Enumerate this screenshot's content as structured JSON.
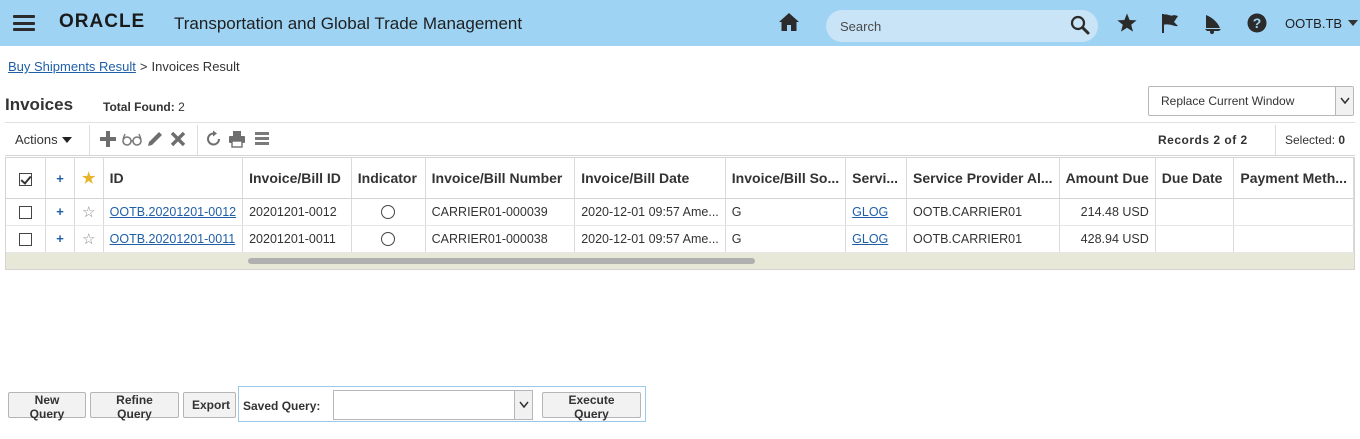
{
  "header": {
    "logo": "ORACLE",
    "app_title": "Transportation and Global Trade Management",
    "search_placeholder": "Search",
    "user": "OOTB.TB"
  },
  "breadcrumb": {
    "parent": "Buy Shipments Result",
    "separator": ">",
    "current": "Invoices Result"
  },
  "page": {
    "title": "Invoices",
    "total_found_label": "Total Found:",
    "total_found_value": "2",
    "window_mode": "Replace Current Window"
  },
  "toolbar": {
    "actions_label": "Actions",
    "records_text": "Records  2  of  2",
    "selected_label": "Selected:",
    "selected_value": "0",
    "icons": [
      "add-icon",
      "view-icon",
      "edit-icon",
      "delete-icon",
      "refresh-icon",
      "print-icon",
      "columns-icon"
    ]
  },
  "table": {
    "columns": [
      "ID",
      "Invoice/Bill ID",
      "Indicator",
      "Invoice/Bill Number",
      "Invoice/Bill Date",
      "Invoice/Bill So...",
      "Servi...",
      "Service Provider Al...",
      "Amount Due",
      "Due Date",
      "Payment Meth..."
    ],
    "rows": [
      {
        "id": "OOTB.20201201-0012",
        "bill_id": "20201201-0012",
        "bill_number": "CARRIER01-000039",
        "bill_date": "2020-12-01 09:57 Ame...",
        "bill_source": "G",
        "service_provider": "GLOG",
        "provider_alias": "OOTB.CARRIER01",
        "amount_due": "214.48 USD",
        "due_date": "",
        "payment_method": ""
      },
      {
        "id": "OOTB.20201201-0011",
        "bill_id": "20201201-0011",
        "bill_number": "CARRIER01-000038",
        "bill_date": "2020-12-01 09:57 Ame...",
        "bill_source": "G",
        "service_provider": "GLOG",
        "provider_alias": "OOTB.CARRIER01",
        "amount_due": "428.94 USD",
        "due_date": "",
        "payment_method": ""
      }
    ]
  },
  "footer": {
    "new_query": "New Query",
    "refine_query": "Refine Query",
    "export": "Export",
    "saved_query_label": "Saved Query:",
    "saved_query_value": "",
    "execute_query": "Execute Query"
  },
  "colors": {
    "header_bg": "#9ed3f3",
    "link": "#1f5fa8",
    "star_active": "#e7b52b"
  }
}
